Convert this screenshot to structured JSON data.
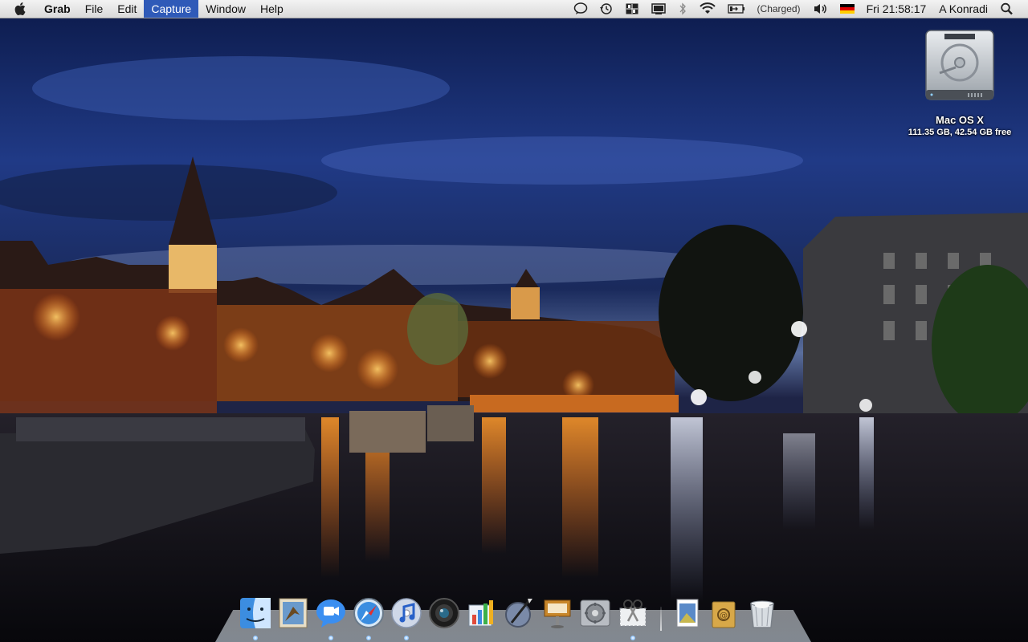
{
  "menubar": {
    "app_name": "Grab",
    "menus": [
      "File",
      "Edit",
      "Capture",
      "Window",
      "Help"
    ],
    "active_menu": "Capture",
    "status": {
      "battery_text": "(Charged)",
      "clock": "Fri 21:58:17",
      "user": "A Konradi"
    },
    "status_icons": [
      "ichat-status-icon",
      "time-machine-icon",
      "spaces-icon",
      "display-mirror-icon",
      "bluetooth-icon",
      "wifi-icon",
      "battery-icon",
      "volume-icon",
      "german-flag-input-icon",
      "spotlight-icon"
    ]
  },
  "desktop": {
    "drive": {
      "name": "Mac OS X",
      "info": "111.35 GB, 42.54 GB free"
    },
    "wallpaper": "night river city scene"
  },
  "dock": {
    "apps": [
      {
        "name": "Finder",
        "icon": "finder-icon",
        "running": true
      },
      {
        "name": "Mail",
        "icon": "mail-icon",
        "running": false
      },
      {
        "name": "iChat",
        "icon": "ichat-icon",
        "running": true
      },
      {
        "name": "Safari",
        "icon": "safari-icon",
        "running": true
      },
      {
        "name": "iTunes",
        "icon": "itunes-icon",
        "running": true
      },
      {
        "name": "Photo Booth",
        "icon": "photo-booth-icon",
        "running": false
      },
      {
        "name": "Numbers",
        "icon": "numbers-icon",
        "running": false
      },
      {
        "name": "Script Editor",
        "icon": "script-editor-icon",
        "running": false
      },
      {
        "name": "Keynote",
        "icon": "keynote-icon",
        "running": false
      },
      {
        "name": "System Preferences",
        "icon": "system-preferences-icon",
        "running": false
      },
      {
        "name": "Grab",
        "icon": "grab-icon",
        "running": true
      }
    ],
    "stacks": [
      {
        "name": "Documents",
        "icon": "documents-stack-icon"
      },
      {
        "name": "Applications",
        "icon": "applications-stack-icon"
      },
      {
        "name": "Trash",
        "icon": "trash-icon"
      }
    ]
  },
  "colors": {
    "menu_highlight": "#2f5ab8",
    "sky": "#1b2c66"
  }
}
